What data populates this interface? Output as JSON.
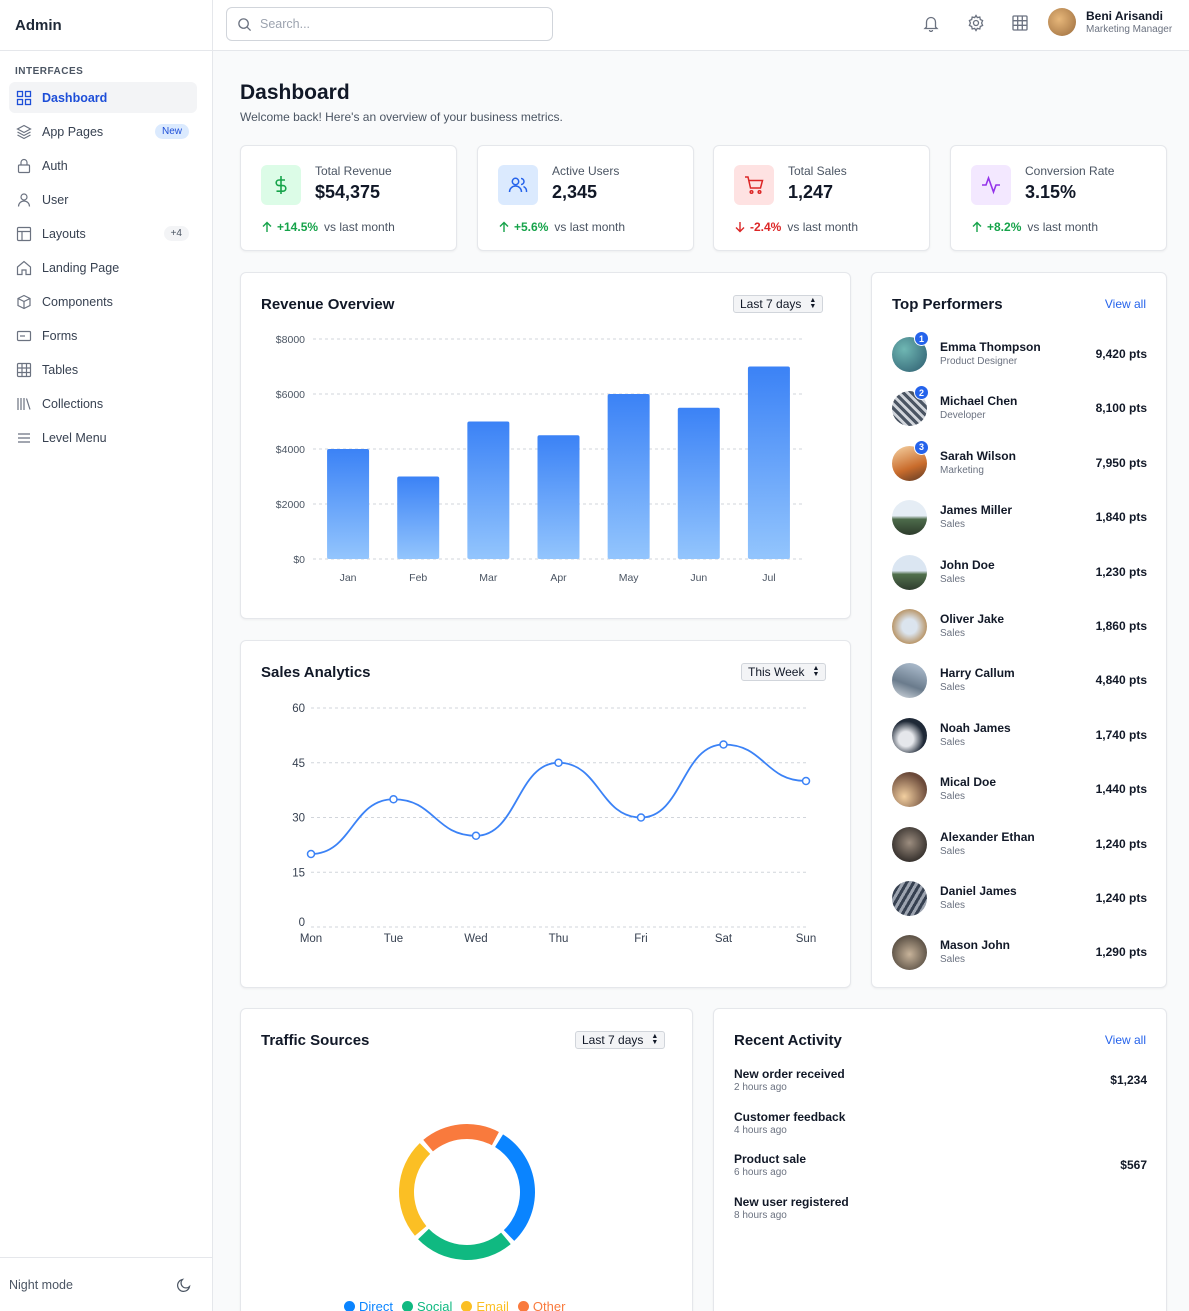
{
  "sidebar": {
    "brand": "Admin",
    "section": "INTERFACES",
    "items": [
      {
        "label": "Dashboard",
        "icon": "grid-icon"
      },
      {
        "label": "App Pages",
        "icon": "layers-icon",
        "badge": "New"
      },
      {
        "label": "Auth",
        "icon": "lock-icon"
      },
      {
        "label": "User",
        "icon": "user-icon"
      },
      {
        "label": "Layouts",
        "icon": "layout-icon",
        "badge": "+4"
      },
      {
        "label": "Landing Page",
        "icon": "home-icon"
      },
      {
        "label": "Components",
        "icon": "box-icon"
      },
      {
        "label": "Forms",
        "icon": "form-icon"
      },
      {
        "label": "Tables",
        "icon": "table-icon"
      },
      {
        "label": "Collections",
        "icon": "library-icon"
      },
      {
        "label": "Level Menu",
        "icon": "menu-icon"
      }
    ],
    "night_mode": "Night mode"
  },
  "header": {
    "search_placeholder": "Search...",
    "user_name": "Beni Arisandi",
    "user_role": "Marketing Manager"
  },
  "page": {
    "title": "Dashboard",
    "subtitle": "Welcome back! Here's an overview of your business metrics."
  },
  "stats": [
    {
      "label": "Total Revenue",
      "value": "$54,375",
      "change": "+14.5%",
      "direction": "up",
      "vs": "vs last month",
      "color": "#16a34a",
      "bg": "#dcfce7"
    },
    {
      "label": "Active Users",
      "value": "2,345",
      "change": "+5.6%",
      "direction": "up",
      "vs": "vs last month",
      "color": "#2563eb",
      "bg": "#dbeafe"
    },
    {
      "label": "Total Sales",
      "value": "1,247",
      "change": "-2.4%",
      "direction": "down",
      "vs": "vs last month",
      "color": "#dc2626",
      "bg": "#fee2e2"
    },
    {
      "label": "Conversion Rate",
      "value": "3.15%",
      "change": "+8.2%",
      "direction": "up",
      "vs": "vs last month",
      "color": "#9333ea",
      "bg": "#f3e8ff"
    }
  ],
  "revenue": {
    "title": "Revenue Overview",
    "select": "Last 7 days"
  },
  "sales": {
    "title": "Sales Analytics",
    "select": "This Week"
  },
  "traffic": {
    "title": "Traffic Sources",
    "select": "Last 7 days"
  },
  "performers": {
    "title": "Top Performers",
    "view_all": "View all",
    "items": [
      {
        "name": "Emma Thompson",
        "role": "Product Designer",
        "points": "9,420 pts",
        "rank": "1"
      },
      {
        "name": "Michael Chen",
        "role": "Developer",
        "points": "8,100 pts",
        "rank": "2"
      },
      {
        "name": "Sarah Wilson",
        "role": "Marketing",
        "points": "7,950 pts",
        "rank": "3"
      },
      {
        "name": "James Miller",
        "role": "Sales",
        "points": "1,840 pts"
      },
      {
        "name": "John Doe",
        "role": "Sales",
        "points": "1,230 pts"
      },
      {
        "name": "Oliver Jake",
        "role": "Sales",
        "points": "1,860 pts"
      },
      {
        "name": "Harry Callum",
        "role": "Sales",
        "points": "4,840 pts"
      },
      {
        "name": "Noah James",
        "role": "Sales",
        "points": "1,740 pts"
      },
      {
        "name": "Mical Doe",
        "role": "Sales",
        "points": "1,440 pts"
      },
      {
        "name": "Alexander Ethan",
        "role": "Sales",
        "points": "1,240 pts"
      },
      {
        "name": "Daniel James",
        "role": "Sales",
        "points": "1,240 pts"
      },
      {
        "name": "Mason John",
        "role": "Sales",
        "points": "1,290 pts"
      }
    ]
  },
  "activity": {
    "title": "Recent Activity",
    "view_all": "View all",
    "items": [
      {
        "title": "New order received",
        "time": "2 hours ago",
        "amount": "$1,234"
      },
      {
        "title": "Customer feedback",
        "time": "4 hours ago",
        "amount": ""
      },
      {
        "title": "Product sale",
        "time": "6 hours ago",
        "amount": "$567"
      },
      {
        "title": "New user registered",
        "time": "8 hours ago",
        "amount": ""
      }
    ]
  },
  "chart_data": [
    {
      "type": "bar",
      "categories": [
        "Jan",
        "Feb",
        "Mar",
        "Apr",
        "May",
        "Jun",
        "Jul"
      ],
      "values": [
        4000,
        3000,
        5000,
        4500,
        6000,
        5500,
        7000
      ],
      "ylim": [
        0,
        8000
      ],
      "yticks": [
        "$0",
        "$2000",
        "$4000",
        "$6000",
        "$8000"
      ],
      "grid": true,
      "colors": [
        "#3b82f6",
        "#93c5fd"
      ]
    },
    {
      "type": "line",
      "categories": [
        "Mon",
        "Tue",
        "Wed",
        "Thu",
        "Fri",
        "Sat",
        "Sun"
      ],
      "values": [
        20,
        35,
        25,
        45,
        30,
        50,
        40
      ],
      "ylim": [
        0,
        60
      ],
      "yticks": [
        "0",
        "15",
        "30",
        "45",
        "60"
      ],
      "grid": true,
      "color": "#3b82f6"
    },
    {
      "type": "pie",
      "donut": true,
      "labels": [
        "Direct",
        "Social",
        "Email",
        "Other"
      ],
      "values": [
        30,
        25,
        25,
        20
      ],
      "colors": [
        "#0a84ff",
        "#10b981",
        "#fbbf24",
        "#f97a3d"
      ],
      "legend": "bottom"
    }
  ]
}
